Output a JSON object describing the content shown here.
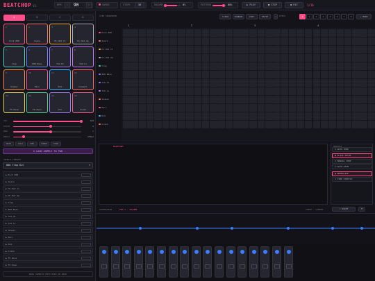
{
  "header": {
    "logo": "BEATCHOP",
    "version": "V1",
    "bpm_label": "BPM",
    "bpm": "90",
    "swing_label": "SWING",
    "swing": "0%",
    "steps_label": "STEPS",
    "steps": "16",
    "volume_label": "VOLUME",
    "volume": "80%",
    "pattern_label": "PATTERN",
    "pattern": "A",
    "play": "▶ PLAY",
    "stop": "■ STOP",
    "rec": "● REC",
    "measure": "1/16"
  },
  "banks": [
    "A",
    "B",
    "C",
    "D"
  ],
  "pads": [
    {
      "num": "1",
      "label": "Kick 808",
      "color": "#ff5a8a"
    },
    {
      "num": "2",
      "label": "Snare",
      "color": "#ff7a6a"
    },
    {
      "num": "3",
      "label": "Hi-Hat Cl",
      "color": "#f5b14a"
    },
    {
      "num": "4",
      "label": "Hi-Hat Op",
      "color": "#b0b0b8"
    },
    {
      "num": "5",
      "label": "Clap",
      "color": "#4ad6c0"
    },
    {
      "num": "6",
      "label": "808 Bass",
      "color": "#6a8cff"
    },
    {
      "num": "7",
      "label": "Tom Hi",
      "color": "#a07aff"
    },
    {
      "num": "8",
      "label": "Tom Lo",
      "color": "#c77aff"
    },
    {
      "num": "9",
      "label": "Shaker",
      "color": "#ff8a4a"
    },
    {
      "num": "10",
      "label": "Perc",
      "color": "#ff5a8a"
    },
    {
      "num": "11",
      "label": "Rim",
      "color": "#4ab8ff"
    },
    {
      "num": "12",
      "label": "Cowbell",
      "color": "#ff6a5a"
    },
    {
      "num": "13",
      "label": "FX Rise",
      "color": "#e0d84a"
    },
    {
      "num": "14",
      "label": "FX Down",
      "color": "#4ad68a"
    },
    {
      "num": "15",
      "label": "Vox",
      "color": "#a07aff"
    },
    {
      "num": "16",
      "label": "Crash",
      "color": "#ff5a8a"
    }
  ],
  "pad_controls": [
    {
      "label": "VOL",
      "value": "100",
      "pct": 1.0
    },
    {
      "label": "PITCH",
      "value": "0",
      "pct": 0.55
    },
    {
      "label": "PAN",
      "value": "C",
      "pct": 0.55
    },
    {
      "label": "DECAY",
      "value": "250ms",
      "pct": 0.15
    }
  ],
  "pad_buttons": [
    "MUTE",
    "SOLO",
    "REV",
    "CHOKE",
    "TRIM"
  ],
  "load_sample": "⊕ LOAD SAMPLE TO PAD",
  "kit_label": "SAMPLE LIBRARY",
  "kit": "808 Trap Kit",
  "tracks": [
    "Kick 808",
    "Snare",
    "Hi-Hat Cl",
    "Hi-Hat Op",
    "Clap",
    "808 Bass",
    "Tom Hi",
    "Tom Lo",
    "Shaker",
    "Perc",
    "Rim",
    "Crash",
    "FX Rise",
    "FX Down"
  ],
  "library_footer": "DRAG SAMPLES ONTO PADS OR GRID",
  "sequencer": {
    "title": "STEP SEQUENCER",
    "tools": [
      "CLEAR",
      "RANDOM",
      "COPY",
      "PASTE"
    ],
    "steps_label": "STEPS",
    "step_buttons": [
      "1",
      "2",
      "3",
      "4",
      "5",
      "6",
      "7",
      "8"
    ],
    "more": "+ MORE",
    "beats": [
      "1",
      "2",
      "3",
      "4"
    ],
    "channels": [
      {
        "name": "Kick 808",
        "color": "#ff5a8a"
      },
      {
        "name": "Snare",
        "color": "#ff7a6a"
      },
      {
        "name": "Hi-Hat Cl",
        "color": "#f5b14a"
      },
      {
        "name": "Hi-Hat Op",
        "color": "#b0b0b8"
      },
      {
        "name": "Clap",
        "color": "#4ad6c0"
      },
      {
        "name": "808 Bass",
        "color": "#6a8cff"
      },
      {
        "name": "Tom Hi",
        "color": "#a07aff"
      },
      {
        "name": "Tom Lo",
        "color": "#c77aff"
      },
      {
        "name": "Shaker",
        "color": "#ff8a4a"
      },
      {
        "name": "Perc",
        "color": "#ff5a8a"
      },
      {
        "name": "Rim",
        "color": "#4ab8ff"
      },
      {
        "name": "Crash",
        "color": "#ff6a5a"
      }
    ]
  },
  "editor": {
    "title": "WAVEFORM",
    "options_title": "PROCESS",
    "options": [
      {
        "label": "◯ AUTO CHOP",
        "selected": false
      },
      {
        "label": "◉ SLICE 16THS",
        "selected": true
      },
      {
        "label": "◯ MANUAL CHOP",
        "selected": false
      },
      {
        "label": "◯ AUTO GAIN",
        "selected": false
      },
      {
        "label": "◉ NORMALIZE",
        "selected": true
      },
      {
        "label": "◯ TIME STRETCH",
        "selected": false
      }
    ]
  },
  "automation": {
    "label": "AUTOMATION",
    "target": "PAD 1 · VOLUME",
    "mode_label": "CURVE · LINEAR",
    "select": "▾ ROUTE",
    "btn": "⟲"
  },
  "accent": "#ff4f8b",
  "note_color": "#3b7dff"
}
